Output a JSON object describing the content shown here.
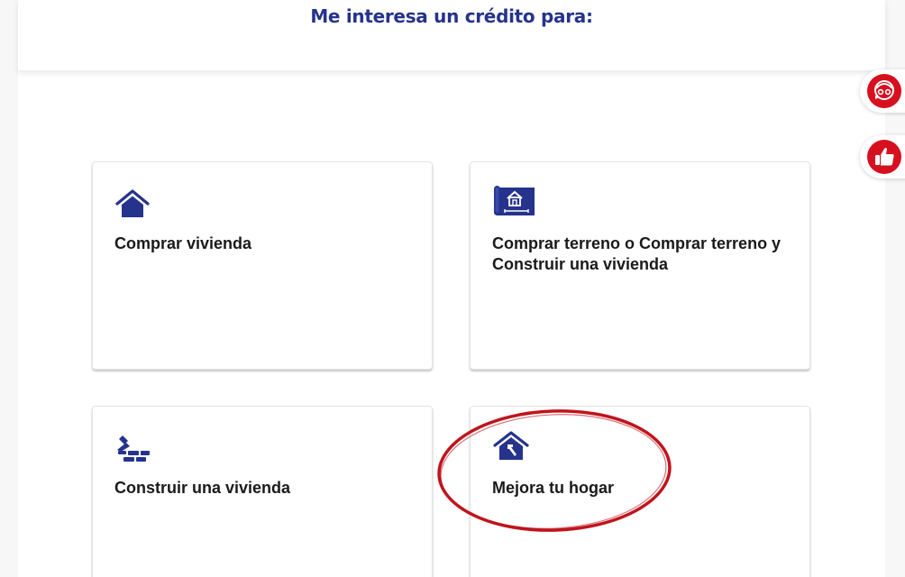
{
  "header": {
    "title": "Me interesa un crédito para:"
  },
  "cards": [
    {
      "label": "Comprar vivienda",
      "icon": "house-icon"
    },
    {
      "label": "Comprar terreno o Comprar terreno y Construir una vivienda",
      "icon": "land-plan-icon"
    },
    {
      "label": "Construir una vivienda",
      "icon": "bricks-trowel-icon"
    },
    {
      "label": "Mejora tu hogar",
      "icon": "house-repair-icon"
    }
  ],
  "side_buttons": [
    {
      "icon": "chat-assistant-icon"
    },
    {
      "icon": "thumbs-up-icon"
    }
  ],
  "colors": {
    "brand_blue": "#25338c",
    "accent_red": "#d6101f",
    "annotation_red": "#c0141c"
  }
}
